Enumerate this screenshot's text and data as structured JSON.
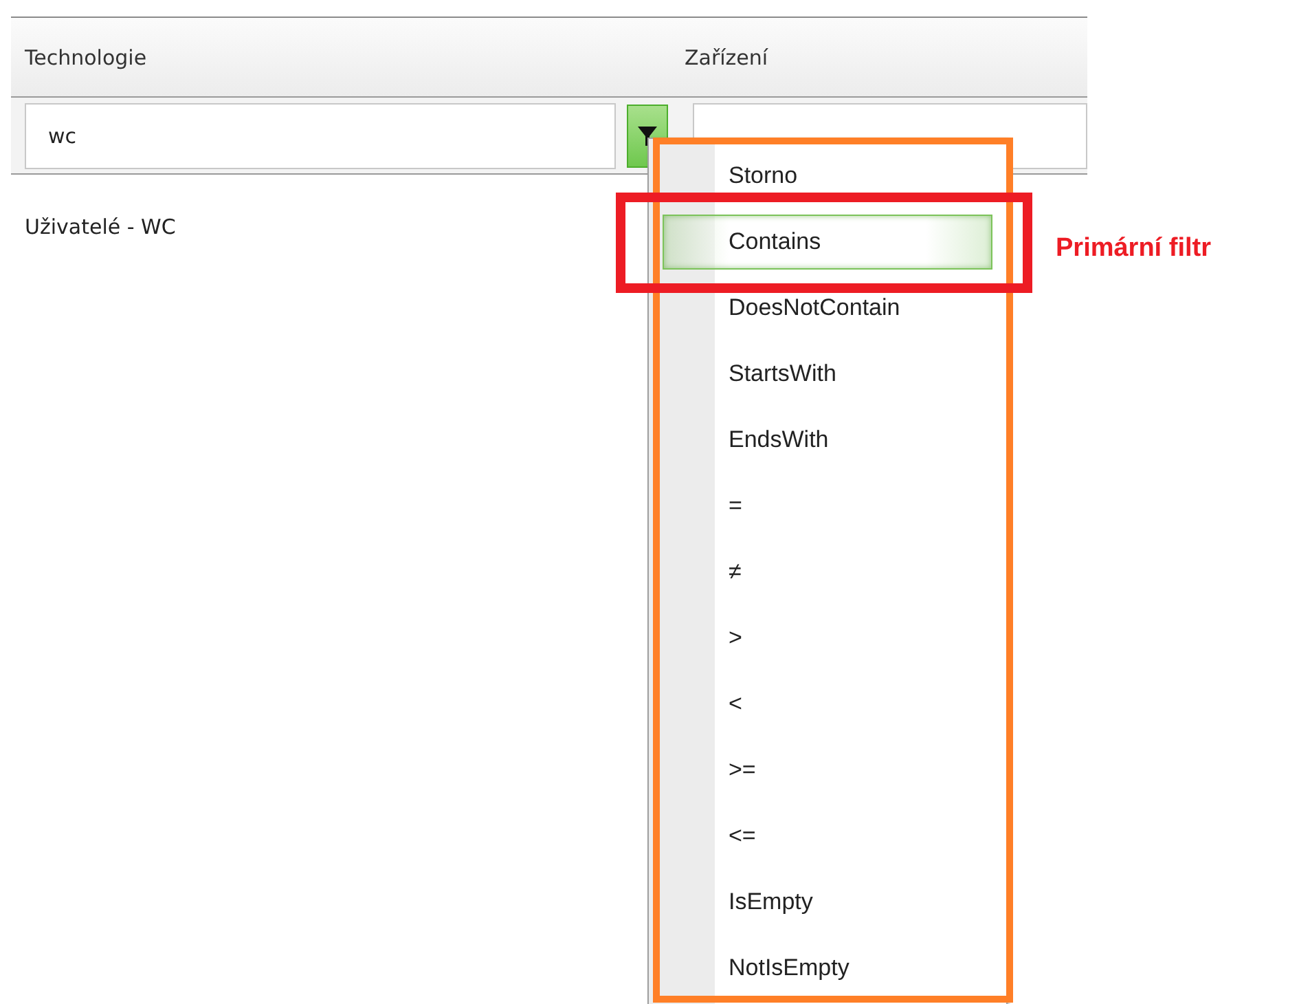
{
  "table": {
    "columns": [
      {
        "label": "Technologie"
      },
      {
        "label": "Zařízení"
      }
    ],
    "filters": [
      {
        "value": "wc",
        "menu_open": true
      }
    ],
    "rows": [
      {
        "cells": [
          "Uživatelé - WC"
        ]
      }
    ]
  },
  "filter_menu": {
    "items": [
      {
        "label": "Storno",
        "selected": false
      },
      {
        "label": "Contains",
        "selected": true
      },
      {
        "label": "DoesNotContain",
        "selected": false
      },
      {
        "label": "StartsWith",
        "selected": false
      },
      {
        "label": "EndsWith",
        "selected": false
      },
      {
        "label": "=",
        "selected": false
      },
      {
        "label": "≠",
        "selected": false
      },
      {
        "label": ">",
        "selected": false
      },
      {
        "label": "<",
        "selected": false
      },
      {
        "label": ">=",
        "selected": false
      },
      {
        "label": "<=",
        "selected": false
      },
      {
        "label": "IsEmpty",
        "selected": false
      },
      {
        "label": "NotIsEmpty",
        "selected": false
      }
    ]
  },
  "annotations": [
    {
      "kind": "menu-frame",
      "color": "#ff7f27"
    },
    {
      "kind": "selected-frame",
      "color": "#ed1c24",
      "label": "Primární filtr"
    }
  ]
}
